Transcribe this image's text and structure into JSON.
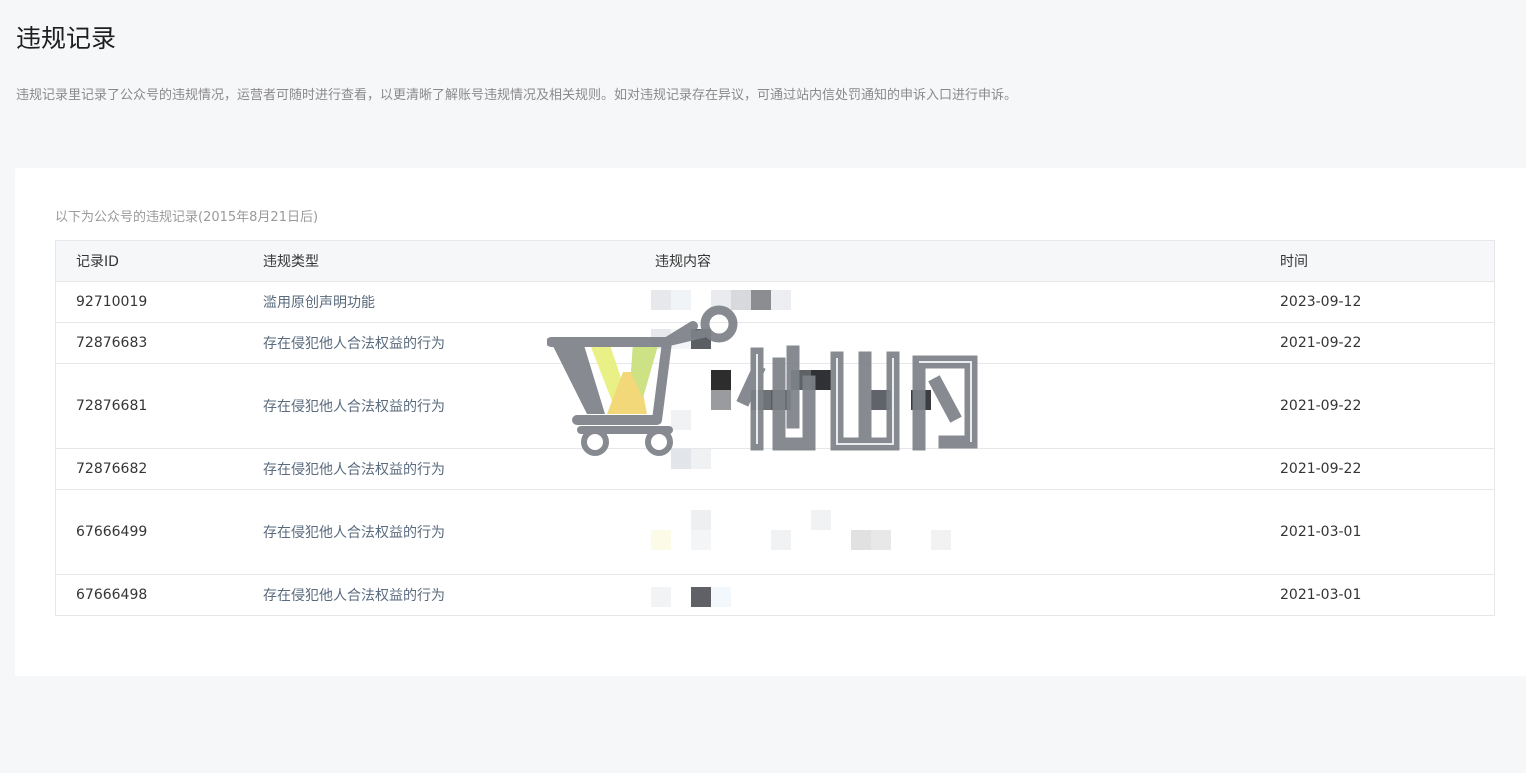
{
  "page": {
    "title": "违规记录",
    "description": "违规记录里记录了公众号的违规情况，运营者可随时进行查看，以更清晰了解账号违规情况及相关规则。如对违规记录存在异议，可通过站内信处罚通知的申诉入口进行申诉。"
  },
  "table": {
    "caption": "以下为公众号的违规记录(2015年8月21日后)",
    "headers": {
      "id": "记录ID",
      "type": "违规类型",
      "content": "违规内容",
      "time": "时间"
    },
    "rows": [
      {
        "id": "92710019",
        "type": "滥用原创声明功能",
        "time": "2023-09-12"
      },
      {
        "id": "72876683",
        "type": "存在侵犯他人合法权益的行为",
        "time": "2021-09-22"
      },
      {
        "id": "72876681",
        "type": "存在侵犯他人合法权益的行为",
        "time": "2021-09-22"
      },
      {
        "id": "72876682",
        "type": "存在侵犯他人合法权益的行为",
        "time": "2021-09-22"
      },
      {
        "id": "67666499",
        "type": "存在侵犯他人合法权益的行为",
        "time": "2021-03-01"
      },
      {
        "id": "67666498",
        "type": "存在侵犯他人合法权益的行为",
        "time": "2021-03-01"
      }
    ]
  },
  "colors": {
    "background": "#f6f7f9",
    "card": "#ffffff",
    "border": "#e7e7eb",
    "violation_type_text": "#5a6b7e"
  },
  "icons": {
    "watermark": "shopping-cart-logo-icon"
  }
}
